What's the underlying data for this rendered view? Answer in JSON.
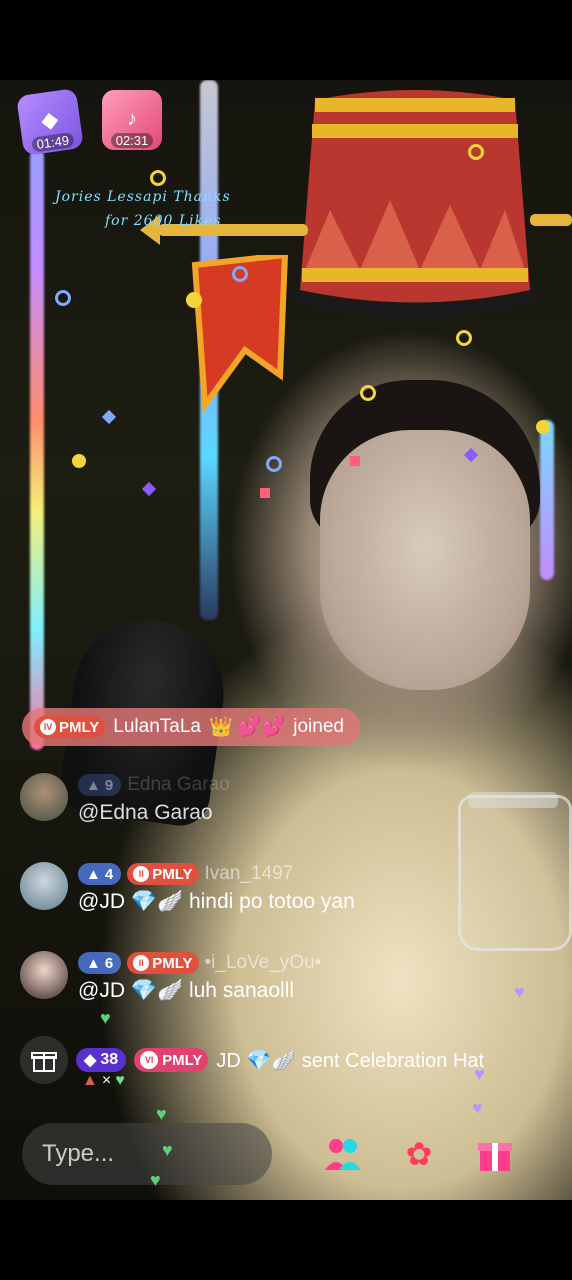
{
  "timers": [
    {
      "icon": "crystal-gift-icon",
      "time": "01:49"
    },
    {
      "icon": "tiktok-chest-icon",
      "time": "02:31"
    }
  ],
  "effect_banner": {
    "line1": "Jories Lessapi  Thanks",
    "line2": "for 2600 Likes"
  },
  "joined_notice": {
    "badge": "PMLY",
    "username": "LulanTaLa",
    "emoji": "👑 💕💕",
    "action": "joined"
  },
  "comments": [
    {
      "level": "9",
      "badge": "",
      "username": "Edna Garao",
      "text": "@Edna Garao"
    },
    {
      "level": "4",
      "badge": "PMLY",
      "username": "Ivan_1497",
      "text": "@JD 💎🪽 hindi po totoo yan"
    },
    {
      "level": "6",
      "badge": "PMLY",
      "username": "•i_LoVe_yOu•",
      "text": "@JD 💎🪽 luh sanaolll"
    }
  ],
  "gift_message": {
    "level": "38",
    "badge": "PMLY",
    "badge_level": "VI",
    "text": "JD 💎🪽 sent Celebration Hat",
    "count": "×"
  },
  "input": {
    "placeholder": "Type..."
  },
  "colors": {
    "pmly": "#e0503f",
    "level_blue": "#5078dc",
    "level_purple": "#5a2fd0",
    "joined_pill": "#e27676"
  }
}
